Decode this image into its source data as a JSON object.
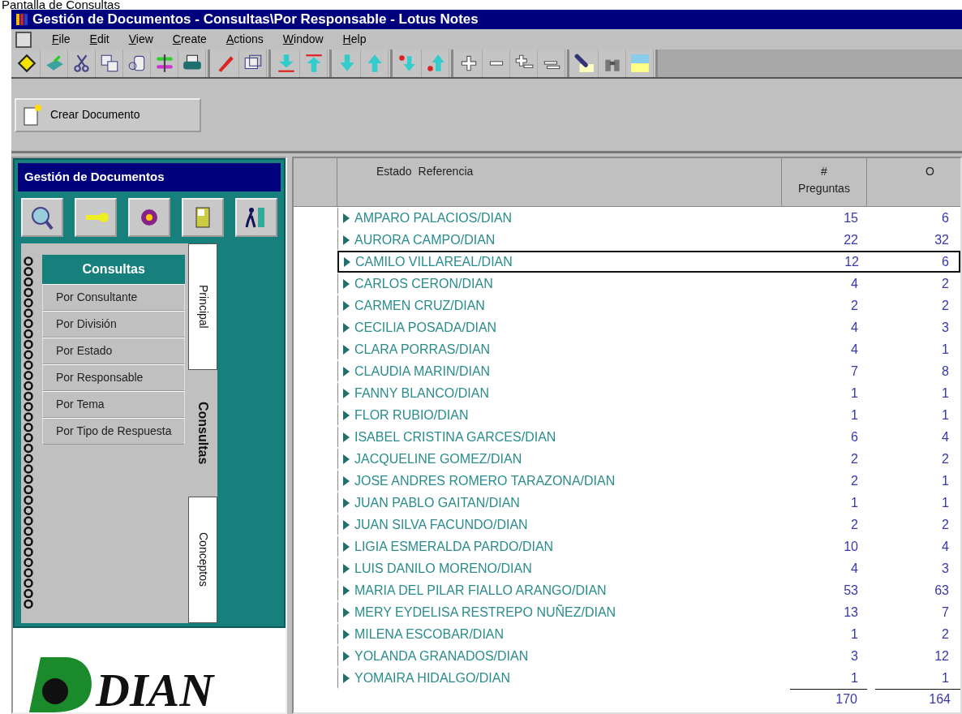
{
  "caption": "Pantalla de Consultas",
  "window": {
    "title": "Gestión de Documentos - Consultas\\Por Responsable - Lotus Notes"
  },
  "menu": [
    "File",
    "Edit",
    "View",
    "Create",
    "Actions",
    "Window",
    "Help"
  ],
  "action_bar": {
    "buttons": [
      "Crear Documento"
    ]
  },
  "navigator": {
    "title": "Gestión de Documentos",
    "section": "Consultas",
    "items": [
      "Por Consultante",
      "Por División",
      "Por Estado",
      "Por Responsable",
      "Por Tema",
      "Por Tipo de Respuesta"
    ],
    "tabs": [
      {
        "label": "Principal",
        "selected": false
      },
      {
        "label": "Consultas",
        "selected": true
      },
      {
        "label": "Conceptos",
        "selected": false
      }
    ],
    "logo": {
      "text": "DIAN"
    }
  },
  "view": {
    "columns": [
      "Estado",
      "Referencia",
      "#\nPreguntas",
      "O"
    ],
    "rows": [
      {
        "name": "AMPARO PALACIOS/DIAN",
        "preguntas": "15",
        "column_3": "6",
        "selected": false
      },
      {
        "name": "AURORA CAMPO/DIAN",
        "preguntas": "22",
        "column_3": "32",
        "selected": false
      },
      {
        "name": "CAMILO VILLAREAL/DIAN",
        "preguntas": "12",
        "column_3": "6",
        "selected": true
      },
      {
        "name": "CARLOS CERON/DIAN",
        "preguntas": "4",
        "column_3": "2",
        "selected": false
      },
      {
        "name": "CARMEN CRUZ/DIAN",
        "preguntas": "2",
        "column_3": "2",
        "selected": false
      },
      {
        "name": "CECILIA POSADA/DIAN",
        "preguntas": "4",
        "column_3": "3",
        "selected": false
      },
      {
        "name": "CLARA PORRAS/DIAN",
        "preguntas": "4",
        "column_3": "1",
        "selected": false
      },
      {
        "name": "CLAUDIA MARIN/DIAN",
        "preguntas": "7",
        "column_3": "8",
        "selected": false
      },
      {
        "name": "FANNY BLANCO/DIAN",
        "preguntas": "1",
        "column_3": "1",
        "selected": false
      },
      {
        "name": "FLOR RUBIO/DIAN",
        "preguntas": "1",
        "column_3": "1",
        "selected": false
      },
      {
        "name": "ISABEL CRISTINA GARCES/DIAN",
        "preguntas": "6",
        "column_3": "4",
        "selected": false
      },
      {
        "name": "JACQUELINE GOMEZ/DIAN",
        "preguntas": "2",
        "column_3": "2",
        "selected": false
      },
      {
        "name": "JOSE ANDRES ROMERO TARAZONA/DIAN",
        "preguntas": "2",
        "column_3": "1",
        "selected": false
      },
      {
        "name": "JUAN PABLO GAITAN/DIAN",
        "preguntas": "1",
        "column_3": "1",
        "selected": false
      },
      {
        "name": "JUAN SILVA FACUNDO/DIAN",
        "preguntas": "2",
        "column_3": "2",
        "selected": false
      },
      {
        "name": "LIGIA ESMERALDA PARDO/DIAN",
        "preguntas": "10",
        "column_3": "4",
        "selected": false
      },
      {
        "name": "LUIS DANILO MORENO/DIAN",
        "preguntas": "4",
        "column_3": "3",
        "selected": false
      },
      {
        "name": "MARIA DEL PILAR FIALLO ARANGO/DIAN",
        "preguntas": "53",
        "column_3": "63",
        "selected": false
      },
      {
        "name": "MERY EYDELISA RESTREPO NUÑEZ/DIAN",
        "preguntas": "13",
        "column_3": "7",
        "selected": false
      },
      {
        "name": "MILENA ESCOBAR/DIAN",
        "preguntas": "1",
        "column_3": "2",
        "selected": false
      },
      {
        "name": "YOLANDA GRANADOS/DIAN",
        "preguntas": "3",
        "column_3": "12",
        "selected": false
      },
      {
        "name": "YOMAIRA HIDALGO/DIAN",
        "preguntas": "1",
        "column_3": "1",
        "selected": false
      }
    ],
    "totals": {
      "preguntas": "170",
      "column_3": "164"
    }
  }
}
